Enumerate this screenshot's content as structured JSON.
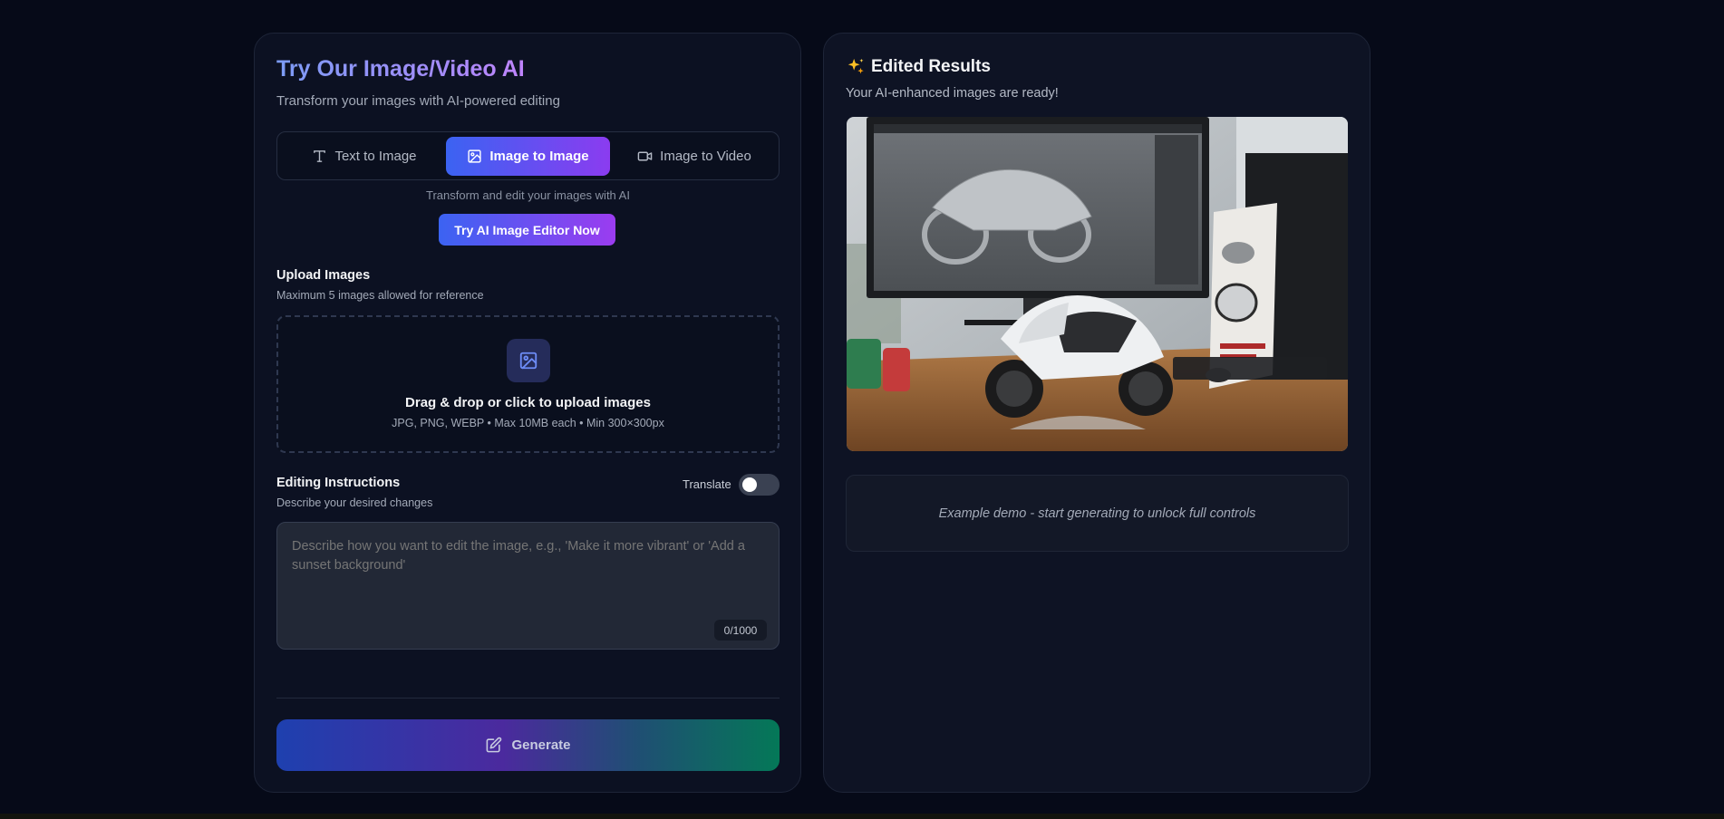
{
  "editor": {
    "title": "Try Our Image/Video AI",
    "subtitle": "Transform your images with AI-powered editing",
    "tabs": [
      {
        "label": "Text to Image",
        "icon": "type-icon",
        "active": false
      },
      {
        "label": "Image to Image",
        "icon": "image-icon",
        "active": true
      },
      {
        "label": "Image to Video",
        "icon": "video-icon",
        "active": false
      }
    ],
    "tab_hint": "Transform and edit your images with AI",
    "cta_label": "Try AI Image Editor Now",
    "upload": {
      "title": "Upload Images",
      "subtitle": "Maximum 5 images allowed for reference",
      "drop_title": "Drag & drop or click to upload images",
      "drop_hint": "JPG, PNG, WEBP • Max 10MB each • Min 300×300px"
    },
    "instructions": {
      "title": "Editing Instructions",
      "subtitle": "Describe your desired changes",
      "translate_label": "Translate",
      "translate_on": false,
      "placeholder": "Describe how you want to edit the image, e.g., 'Make it more vibrant' or 'Add a sunset background'",
      "value": "",
      "counter": "0/1000"
    },
    "generate_label": "Generate"
  },
  "results": {
    "icon": "sparkles-icon",
    "title": "Edited Results",
    "subtitle": "Your AI-enhanced images are ready!",
    "demo_note": "Example demo - start generating to unlock full controls"
  },
  "colors": {
    "background": "#060a18",
    "panel": "#0c1122",
    "accent_start": "#3b63f2",
    "accent_end": "#8b3cf0",
    "generate_end": "#047857"
  }
}
